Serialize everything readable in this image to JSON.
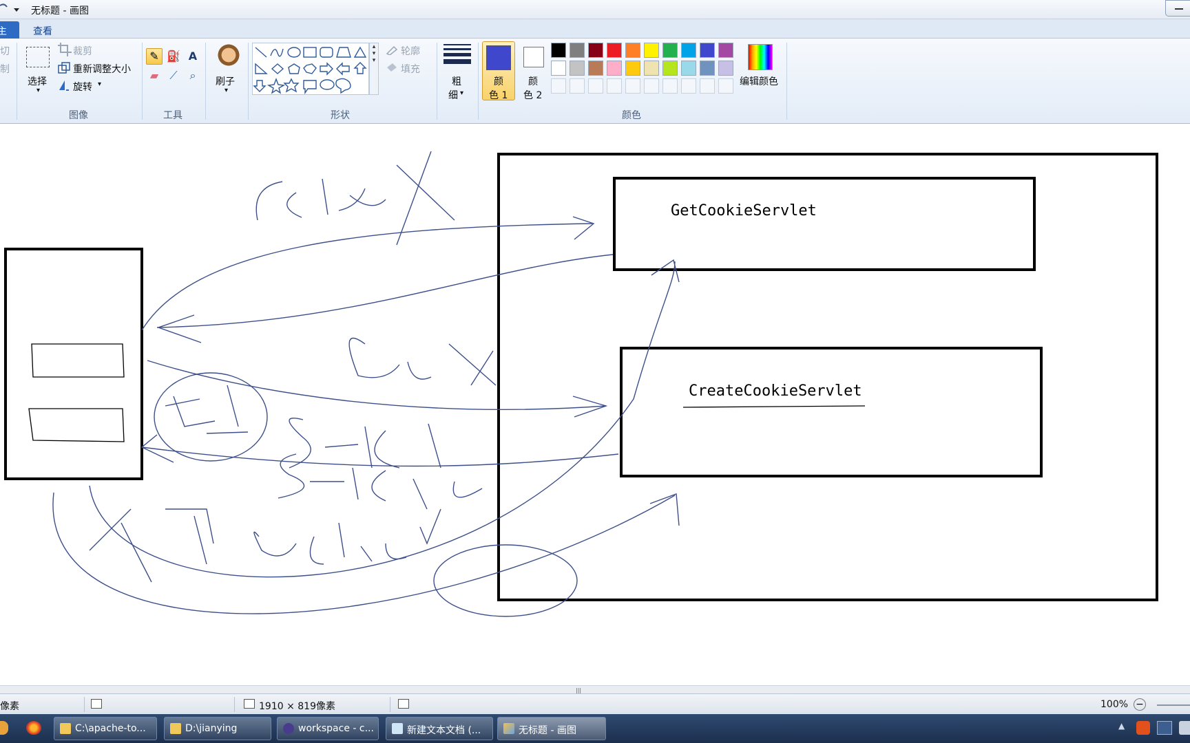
{
  "window": {
    "title": "无标题 - 画图"
  },
  "tabs": [
    {
      "label": "主页"
    },
    {
      "label": "查看"
    }
  ],
  "ribbon": {
    "clipboard": {
      "cut": "切",
      "copy": "制"
    },
    "image": {
      "group": "图像",
      "select": "选择",
      "crop": "裁剪",
      "resize": "重新调整大小",
      "rotate": "旋转"
    },
    "tools": {
      "group": "工具"
    },
    "brush": {
      "label": "刷子"
    },
    "shapes": {
      "group": "形状",
      "outline": "轮廓",
      "fill": "填充"
    },
    "size": {
      "line1": "粗",
      "line2": "细"
    },
    "colors": {
      "group": "颜色",
      "color1_a": "颜",
      "color1_b": "色 1",
      "color2_a": "颜",
      "color2_b": "色 2",
      "edit": "编辑颜色",
      "color1_value": "#3f48cc",
      "palette_row1": [
        "#000000",
        "#7f7f7f",
        "#880015",
        "#ed1c24",
        "#ff7f27",
        "#fff200",
        "#22b14c",
        "#00a2e8",
        "#3f48cc",
        "#a349a4"
      ],
      "palette_row2": [
        "#ffffff",
        "#c3c3c3",
        "#b97a57",
        "#ffaec9",
        "#ffc90e",
        "#efe4b0",
        "#b5e61d",
        "#99d9ea",
        "#7092be",
        "#c8bfe7"
      ]
    }
  },
  "canvas": {
    "get_servlet": "GetCookieServlet",
    "create_servlet": "CreateCookieServlet"
  },
  "statusbar": {
    "pixel": "像素",
    "size": "1910 × 819像素",
    "zoom": "100%"
  },
  "taskbar": {
    "items": [
      {
        "label": "C:\\apache-to..."
      },
      {
        "label": "D:\\jianying"
      },
      {
        "label": "workspace - c..."
      },
      {
        "label": "新建文本文档 (..."
      },
      {
        "label": "无标题 - 画图"
      }
    ]
  }
}
